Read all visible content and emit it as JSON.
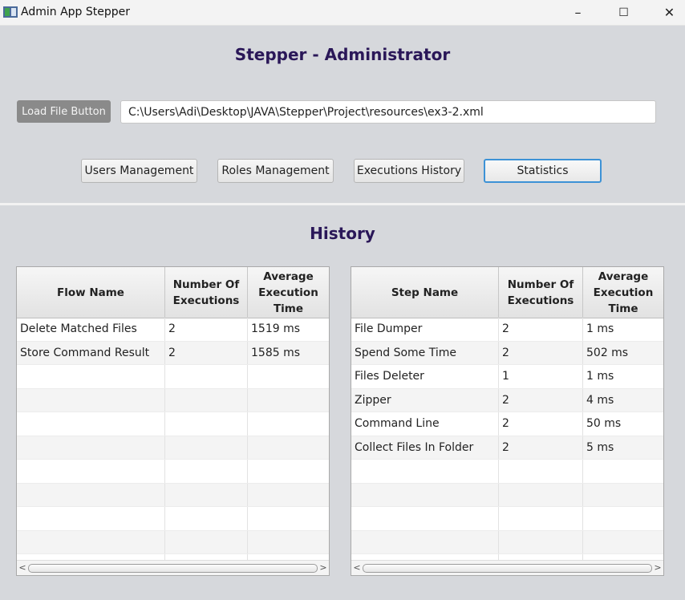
{
  "window": {
    "title": "Admin App Stepper",
    "minimize": "–",
    "maximize": "☐",
    "close": "✕"
  },
  "header": {
    "title": "Stepper - Administrator"
  },
  "load": {
    "button_label": "Load File Button",
    "path_value": "C:\\Users\\Adi\\Desktop\\JAVA\\Stepper\\Project\\resources\\ex3-2.xml"
  },
  "nav": {
    "users": "Users Management",
    "roles": "Roles Management",
    "executions": "Executions History",
    "statistics": "Statistics"
  },
  "section": {
    "title": "History"
  },
  "flow_table": {
    "headers": [
      "Flow Name",
      "Number Of Executions",
      "Average Execution Time"
    ],
    "rows": [
      [
        "Delete Matched Files",
        "2",
        "1519 ms"
      ],
      [
        "Store Command Result",
        "2",
        "1585 ms"
      ]
    ]
  },
  "step_table": {
    "headers": [
      "Step Name",
      "Number Of Executions",
      "Average Execution Time"
    ],
    "rows": [
      [
        "File Dumper",
        "2",
        "1 ms"
      ],
      [
        "Spend Some Time",
        "2",
        "502 ms"
      ],
      [
        "Files Deleter",
        "1",
        "1 ms"
      ],
      [
        "Zipper",
        "2",
        "4 ms"
      ],
      [
        "Command Line",
        "2",
        "50 ms"
      ],
      [
        "Collect Files In Folder",
        "2",
        "5 ms"
      ]
    ]
  },
  "scroll": {
    "left": "<",
    "right": ">"
  },
  "colors": {
    "title": "#2a1758",
    "active_border": "#3d92d6",
    "load_button": "#8a8a8a",
    "background": "#d6d8dc"
  }
}
